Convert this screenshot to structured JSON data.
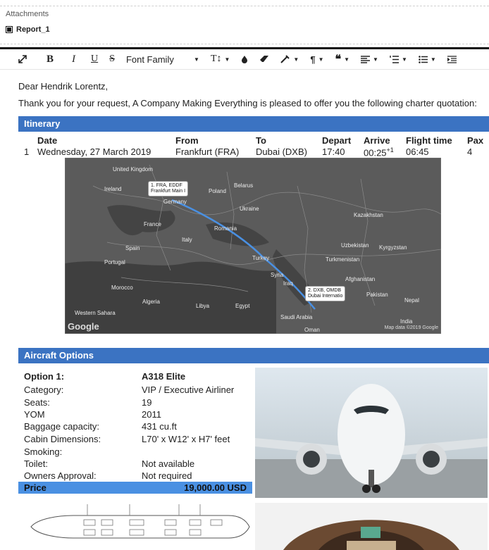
{
  "attachments": {
    "title": "Attachments",
    "file": "Report_1"
  },
  "toolbar": {
    "font_family": "Font Family",
    "size": "T↕",
    "icons": [
      "expand-icon",
      "bold-icon",
      "italic-icon",
      "underline-icon",
      "strikethrough-icon",
      "font-family-select",
      "text-size-icon",
      "text-color-icon",
      "eraser-icon",
      "highlight-icon",
      "paragraph-icon",
      "quote-icon",
      "align-icon",
      "ordered-list-icon",
      "unordered-list-icon",
      "indent-icon"
    ]
  },
  "letter": {
    "greeting": "Dear Hendrik Lorentz,",
    "intro": "Thank you for your request, A Company Making Everything is pleased to offer you the following charter quotation:"
  },
  "itinerary": {
    "title": "Itinerary",
    "headers": [
      "Date",
      "From",
      "To",
      "Depart",
      "Arrive",
      "Flight time",
      "Pax"
    ],
    "row": {
      "num": "1",
      "date": "Wednesday, 27 March 2019",
      "from": "Frankfurt (FRA)",
      "to": "Dubai (DXB)",
      "depart": "17:40",
      "arrive": "00:25",
      "arrive_sup": "+1",
      "flight_time": "06:45",
      "pax": "4"
    }
  },
  "map": {
    "labels": [
      "United Kingdom",
      "Ireland",
      "Germany",
      "Poland",
      "Belarus",
      "Ukraine",
      "France",
      "Romania",
      "Italy",
      "Spain",
      "Portugal",
      "Turkey",
      "Syria",
      "Iraq",
      "Kazakhstan",
      "Uzbekistan",
      "Kyrgyzstan",
      "Turkmenistan",
      "Afghanistan",
      "Pakistan",
      "Nepal",
      "India",
      "Morocco",
      "Algeria",
      "Libya",
      "Egypt",
      "Saudi Arabia",
      "Oman",
      "Western Sahara"
    ],
    "marker1": {
      "line1": "1. FRA, EDDF",
      "line2": "Frankfurt Main I"
    },
    "marker2": {
      "line1": "2. DXB, OMDB",
      "line2": "Dubai Internatio"
    },
    "logo": "Google",
    "copyright": "Map data ©2019 Google"
  },
  "aircraft": {
    "title": "Aircraft Options",
    "option_label": "Option 1:",
    "option_name": "A318 Elite",
    "specs": [
      {
        "label": "Category:",
        "value": "VIP / Executive Airliner"
      },
      {
        "label": "Seats:",
        "value": "19"
      },
      {
        "label": "YOM",
        "value": "2011"
      },
      {
        "label": "Baggage capacity:",
        "value": "431 cu.ft"
      },
      {
        "label": "Cabin Dimensions:",
        "value": "L70' x W12' x H7' feet"
      },
      {
        "label": "Smoking:",
        "value": ""
      },
      {
        "label": "Toilet:",
        "value": "Not available"
      },
      {
        "label": "Owners Approval:",
        "value": "Not required"
      }
    ],
    "price_label": "Price",
    "price_value": "19,000.00 USD"
  }
}
